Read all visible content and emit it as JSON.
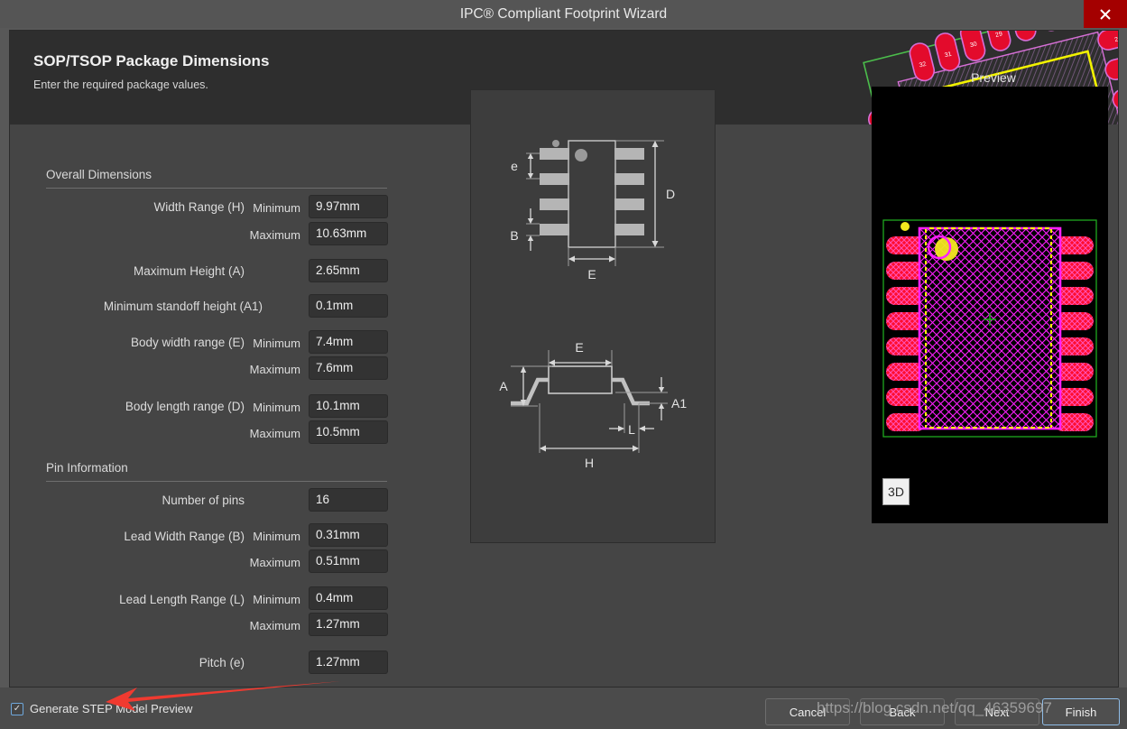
{
  "window": {
    "title": "IPC® Compliant Footprint Wizard",
    "close_label": "close-icon"
  },
  "header": {
    "title": "SOP/TSOP Package Dimensions",
    "subtitle": "Enter the required package values."
  },
  "form": {
    "sections": [
      {
        "title": "Overall Dimensions",
        "fields": [
          {
            "label": "Width Range (H)",
            "min_label": "Minimum",
            "min_value": "9.97mm",
            "max_label": "Maximum",
            "max_value": "10.63mm"
          },
          {
            "label": "Maximum Height (A)",
            "min_label": "",
            "min_value": "2.65mm",
            "max_label": "",
            "max_value": ""
          },
          {
            "label": "Minimum standoff height (A1)",
            "min_label": "",
            "min_value": "0.1mm",
            "max_label": "",
            "max_value": ""
          },
          {
            "label": "Body width range (E)",
            "min_label": "Minimum",
            "min_value": "7.4mm",
            "max_label": "Maximum",
            "max_value": "7.6mm"
          },
          {
            "label": "Body length range (D)",
            "min_label": "Minimum",
            "min_value": "10.1mm",
            "max_label": "Maximum",
            "max_value": "10.5mm"
          }
        ]
      },
      {
        "title": "Pin Information",
        "fields": [
          {
            "label": "Number of pins",
            "min_label": "",
            "min_value": "16",
            "max_label": "",
            "max_value": ""
          },
          {
            "label": "Lead Width Range (B)",
            "min_label": "Minimum",
            "min_value": "0.31mm",
            "max_label": "Maximum",
            "max_value": "0.51mm"
          },
          {
            "label": "Lead Length Range (L)",
            "min_label": "Minimum",
            "min_value": "0.4mm",
            "max_label": "Maximum",
            "max_value": "1.27mm"
          },
          {
            "label": "Pitch (e)",
            "min_label": "",
            "min_value": "1.27mm",
            "max_label": "",
            "max_value": ""
          }
        ]
      }
    ]
  },
  "diagram": {
    "top_view_labels": {
      "pitch": "e",
      "lead_width": "B",
      "body_length": "D",
      "body_width": "E"
    },
    "side_view_labels": {
      "body_width": "E",
      "height": "A",
      "standoff": "A1",
      "lead_length": "L",
      "overall_width": "H"
    }
  },
  "preview": {
    "label": "Preview",
    "button_3d": "3D",
    "pins_per_side": 8,
    "colors": {
      "pad": "#ff1040",
      "pad_outline": "#ff20ff",
      "courtyard": "#22aa22",
      "silkscreen": "#ffff00",
      "background": "#000000"
    }
  },
  "footer": {
    "checkbox": {
      "label": "Generate STEP Model Preview",
      "checked": true,
      "mark": "✓"
    },
    "buttons": [
      {
        "label": "Cancel",
        "mnemonic": "",
        "focused": false
      },
      {
        "label": "Back",
        "mnemonic": "B",
        "focused": false
      },
      {
        "label": "Next",
        "mnemonic": "N",
        "focused": false
      },
      {
        "label": "Finish",
        "mnemonic": "F",
        "focused": true
      }
    ]
  },
  "watermark": {
    "text": "https://blog.csdn.net/qq_46359697"
  },
  "colors": {
    "window_bg": "#585858",
    "dialog_bg": "#454545",
    "header_band": "#2e2e2e",
    "field_bg": "#333333",
    "accent_focus": "#8fbce6",
    "close_red": "#a40000",
    "annotation_red": "#f03a30"
  }
}
